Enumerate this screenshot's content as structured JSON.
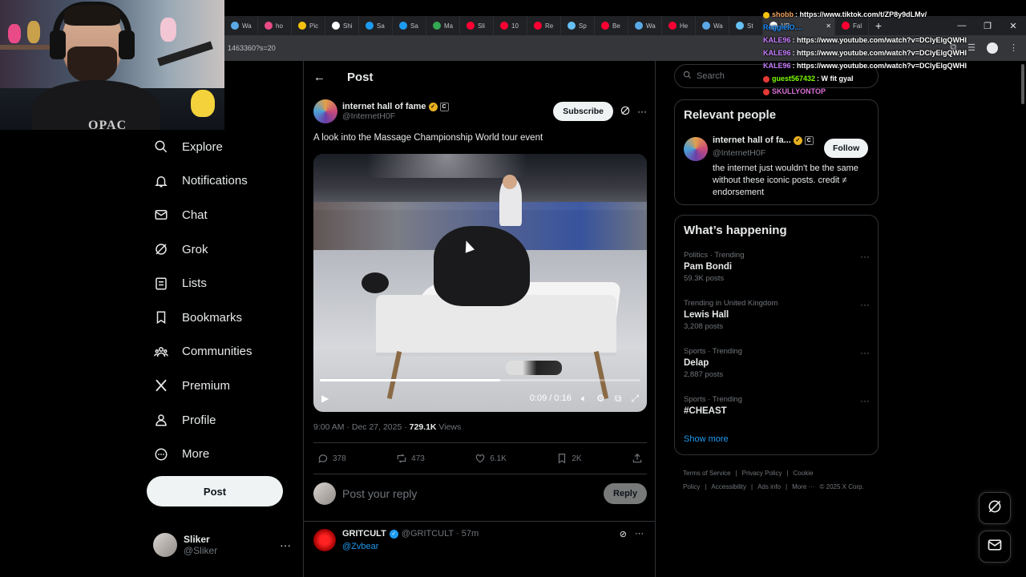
{
  "browser": {
    "tabs": [
      {
        "label": "Wa",
        "color": "#5aa9e6"
      },
      {
        "label": "ho",
        "color": "#e94b86"
      },
      {
        "label": "Pic",
        "color": "#f4c20d"
      },
      {
        "label": "Shi",
        "color": "#ffffff"
      },
      {
        "label": "Sa",
        "color": "#1d9bf0"
      },
      {
        "label": "Sa",
        "color": "#1d9bf0"
      },
      {
        "label": "Ma",
        "color": "#34a853"
      },
      {
        "label": "Sli",
        "color": "#ff0033"
      },
      {
        "label": "10",
        "color": "#ff0033"
      },
      {
        "label": "Re",
        "color": "#ff0033"
      },
      {
        "label": "Sp",
        "color": "#66c0f4"
      },
      {
        "label": "Be",
        "color": "#ff0033"
      },
      {
        "label": "Wa",
        "color": "#5aa9e6"
      },
      {
        "label": "He",
        "color": "#ff0033"
      },
      {
        "label": "Wa",
        "color": "#5aa9e6"
      },
      {
        "label": "St",
        "color": "#66c0f4"
      }
    ],
    "active_tab": {
      "label": "NR",
      "color": "#ffffff"
    },
    "extra_tab": {
      "label": "Fal",
      "color": "#ff0033"
    },
    "url_fragment": "1463360?s=20"
  },
  "chat": [
    {
      "user": "shobb",
      "color": "#f4a460",
      "msg": "https://www.tiktok.com/t/ZP8y9dLMv/",
      "badge": "#f4c20d"
    },
    {
      "user": "ReggieIO....",
      "color": "#1e90ff",
      "msg": "",
      "badge": ""
    },
    {
      "user": "KALE96",
      "color": "#c77dff",
      "msg": "https://www.youtube.com/watch?v=DClyElgQWHI",
      "badge": ""
    },
    {
      "user": "KALE96",
      "color": "#c77dff",
      "msg": "https://www.youtube.com/watch?v=DClyElgQWHI",
      "badge": ""
    },
    {
      "user": "KALE96",
      "color": "#c77dff",
      "msg": "https://www.youtube.com/watch?v=DClyElgQWHI",
      "badge": ""
    },
    {
      "user": "guest567432",
      "color": "#7fff00",
      "msg": "W fit gyal",
      "badge": "#e53935"
    },
    {
      "user": "SKULLYONTOP",
      "color": "#da70d6",
      "msg": "",
      "badge": "#e53935"
    }
  ],
  "nav": {
    "items": [
      {
        "label": "Explore",
        "icon": "search-icon"
      },
      {
        "label": "Notifications",
        "icon": "bell-icon"
      },
      {
        "label": "Chat",
        "icon": "mail-icon"
      },
      {
        "label": "Grok",
        "icon": "grok-icon"
      },
      {
        "label": "Lists",
        "icon": "list-icon"
      },
      {
        "label": "Bookmarks",
        "icon": "bookmark-icon"
      },
      {
        "label": "Communities",
        "icon": "communities-icon"
      },
      {
        "label": "Premium",
        "icon": "x-logo-icon"
      },
      {
        "label": "Profile",
        "icon": "person-icon"
      },
      {
        "label": "More",
        "icon": "more-circle-icon"
      }
    ],
    "post_label": "Post",
    "account": {
      "display_name": "Sliker",
      "handle": "@Sliker"
    }
  },
  "post": {
    "header_title": "Post",
    "author_name": "internet hall of fame",
    "author_handle": "@InternetH0F",
    "subscribe_label": "Subscribe",
    "text": "A look into the Massage Championship World tour event",
    "video": {
      "current": "0:09",
      "duration": "0:16",
      "time_display": "0:09 / 0:16",
      "progress": 0.5625
    },
    "timestamp": "9:00 AM · Dec 27, 2025 · ",
    "views_count": "729.1K",
    "views_label": " Views",
    "stats": {
      "replies": "378",
      "reposts": "473",
      "likes": "6.1K",
      "bookmarks": "2K"
    },
    "reply_placeholder": "Post your reply",
    "reply_button": "Reply"
  },
  "reply": {
    "name": "GRITCULT",
    "handle": "@GRITCULT · 57m",
    "mention": "@Zvbear"
  },
  "sidebar": {
    "search_placeholder": "Search",
    "relevant_title": "Relevant people",
    "relevant_name": "internet hall of fa...",
    "relevant_handle": "@InternetH0F",
    "follow_label": "Follow",
    "relevant_bio": "the internet just wouldn't be the same without these iconic posts. credit ≠ endorsement",
    "happening_title": "What’s happening",
    "trends": [
      {
        "meta": "Politics · Trending",
        "name": "Pam Bondi",
        "count": "59.3K posts"
      },
      {
        "meta": "Trending in United Kingdom",
        "name": "Lewis Hall",
        "count": "3,208 posts"
      },
      {
        "meta": "Sports · Trending",
        "name": "Delap",
        "count": "2,887 posts"
      },
      {
        "meta": "Sports · Trending",
        "name": "#CHEAST",
        "count": ""
      }
    ],
    "show_more": "Show more",
    "footer": [
      "Terms of Service",
      "|",
      "Privacy Policy",
      "|",
      "Cookie Policy",
      "|",
      "Accessibility",
      "|",
      "Ads info",
      "|",
      "More ···",
      "© 2025 X Corp."
    ]
  },
  "webcam": {
    "shirt_text": "OPAC"
  }
}
